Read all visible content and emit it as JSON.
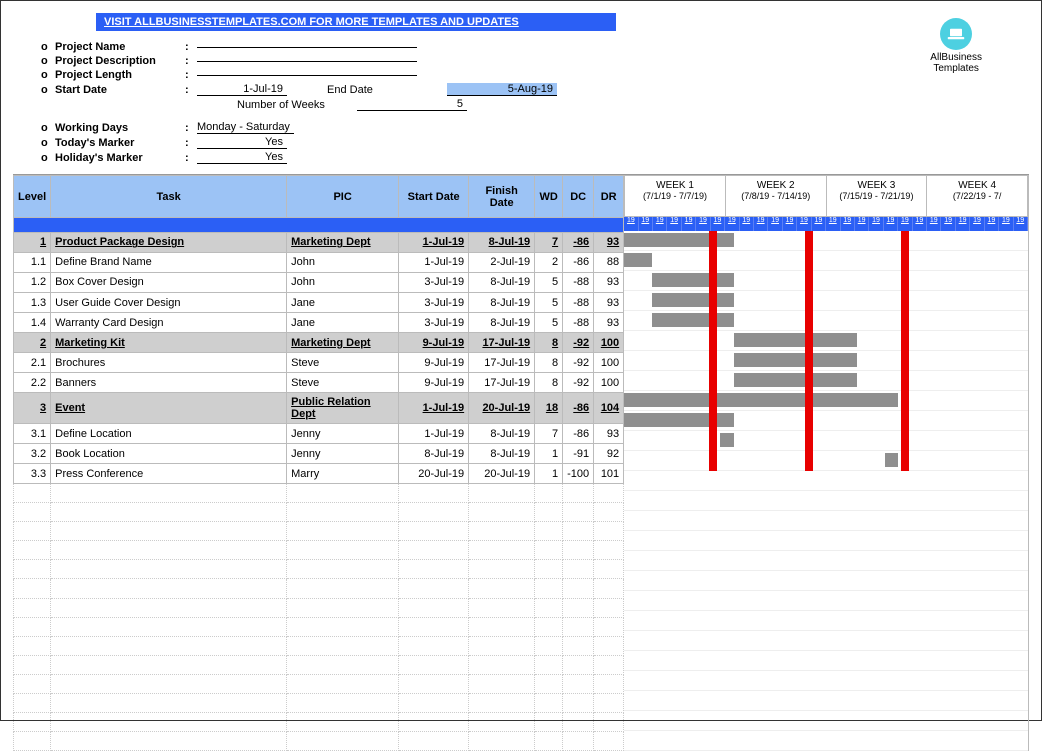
{
  "header_link": "VISIT ALLBUSINESSTEMPLATES.COM FOR MORE TEMPLATES AND UPDATES",
  "logo": {
    "line1": "AllBusiness",
    "line2": "Templates"
  },
  "meta": {
    "rows": [
      {
        "label": "Project Name",
        "value": ""
      },
      {
        "label": "Project Description",
        "value": ""
      },
      {
        "label": "Project Length",
        "value": ""
      },
      {
        "label": "Start Date",
        "value": "1-Jul-19",
        "second_label": "End Date",
        "second_value": "5-Aug-19",
        "second_hl": true
      },
      {
        "label": "",
        "value": "",
        "second_label": "Number of Weeks",
        "second_value": "5"
      },
      {
        "label": "Working Days",
        "value": "Monday - Saturday"
      },
      {
        "label": "Today's Marker",
        "value": "Yes"
      },
      {
        "label": "Holiday's Marker",
        "value": "Yes"
      }
    ]
  },
  "columns": [
    "Level",
    "Task",
    "PIC",
    "Start Date",
    "Finish Date",
    "WD",
    "DC",
    "DR"
  ],
  "weeks": [
    {
      "name": "WEEK 1",
      "range": "(7/1/19 - 7/7/19)"
    },
    {
      "name": "WEEK 2",
      "range": "(7/8/19 - 7/14/19)"
    },
    {
      "name": "WEEK 3",
      "range": "(7/15/19 - 7/21/19)"
    },
    {
      "name": "WEEK 4",
      "range": "(7/22/19 - 7/"
    }
  ],
  "day_label": "19",
  "rows": [
    {
      "level": "1",
      "task": "Product Package Design",
      "pic": "Marketing Dept",
      "sd": "1-Jul-19",
      "fd": "8-Jul-19",
      "wd": "7",
      "dc": "-86",
      "dr": "93",
      "group": true,
      "bar_start": 0,
      "bar_days": 8
    },
    {
      "level": "1.1",
      "task": "Define Brand Name",
      "pic": "John",
      "sd": "1-Jul-19",
      "fd": "2-Jul-19",
      "wd": "2",
      "dc": "-86",
      "dr": "88",
      "bar_start": 0,
      "bar_days": 2
    },
    {
      "level": "1.2",
      "task": "Box Cover Design",
      "pic": "John",
      "sd": "3-Jul-19",
      "fd": "8-Jul-19",
      "wd": "5",
      "dc": "-88",
      "dr": "93",
      "bar_start": 2,
      "bar_days": 6
    },
    {
      "level": "1.3",
      "task": "User Guide Cover Design",
      "pic": "Jane",
      "sd": "3-Jul-19",
      "fd": "8-Jul-19",
      "wd": "5",
      "dc": "-88",
      "dr": "93",
      "bar_start": 2,
      "bar_days": 6
    },
    {
      "level": "1.4",
      "task": "Warranty Card Design",
      "pic": "Jane",
      "sd": "3-Jul-19",
      "fd": "8-Jul-19",
      "wd": "5",
      "dc": "-88",
      "dr": "93",
      "bar_start": 2,
      "bar_days": 6
    },
    {
      "level": "2",
      "task": "Marketing Kit",
      "pic": "Marketing Dept",
      "sd": "9-Jul-19",
      "fd": "17-Jul-19",
      "wd": "8",
      "dc": "-92",
      "dr": "100",
      "group": true,
      "bar_start": 8,
      "bar_days": 9
    },
    {
      "level": "2.1",
      "task": "Brochures",
      "pic": "Steve",
      "sd": "9-Jul-19",
      "fd": "17-Jul-19",
      "wd": "8",
      "dc": "-92",
      "dr": "100",
      "bar_start": 8,
      "bar_days": 9
    },
    {
      "level": "2.2",
      "task": "Banners",
      "pic": "Steve",
      "sd": "9-Jul-19",
      "fd": "17-Jul-19",
      "wd": "8",
      "dc": "-92",
      "dr": "100",
      "bar_start": 8,
      "bar_days": 9
    },
    {
      "level": "3",
      "task": "Event",
      "pic": "Public Relation Dept",
      "sd": "1-Jul-19",
      "fd": "20-Jul-19",
      "wd": "18",
      "dc": "-86",
      "dr": "104",
      "group": true,
      "bar_start": 0,
      "bar_days": 20
    },
    {
      "level": "3.1",
      "task": "Define Location",
      "pic": "Jenny",
      "sd": "1-Jul-19",
      "fd": "8-Jul-19",
      "wd": "7",
      "dc": "-86",
      "dr": "93",
      "bar_start": 0,
      "bar_days": 8
    },
    {
      "level": "3.2",
      "task": "Book Location",
      "pic": "Jenny",
      "sd": "8-Jul-19",
      "fd": "8-Jul-19",
      "wd": "1",
      "dc": "-91",
      "dr": "92",
      "bar_start": 7,
      "bar_days": 1
    },
    {
      "level": "3.3",
      "task": "Press Conference",
      "pic": "Marry",
      "sd": "20-Jul-19",
      "fd": "20-Jul-19",
      "wd": "1",
      "dc": "-100",
      "dr": "101",
      "bar_start": 19,
      "bar_days": 1
    }
  ],
  "markers_days": [
    7,
    14,
    21
  ],
  "empty_rows": 14,
  "chart_data": {
    "type": "gantt",
    "x_start": "2019-07-01",
    "tasks": [
      {
        "name": "Product Package Design",
        "start": "2019-07-01",
        "end": "2019-07-08"
      },
      {
        "name": "Define Brand Name",
        "start": "2019-07-01",
        "end": "2019-07-02"
      },
      {
        "name": "Box Cover Design",
        "start": "2019-07-03",
        "end": "2019-07-08"
      },
      {
        "name": "User Guide Cover Design",
        "start": "2019-07-03",
        "end": "2019-07-08"
      },
      {
        "name": "Warranty Card Design",
        "start": "2019-07-03",
        "end": "2019-07-08"
      },
      {
        "name": "Marketing Kit",
        "start": "2019-07-09",
        "end": "2019-07-17"
      },
      {
        "name": "Brochures",
        "start": "2019-07-09",
        "end": "2019-07-17"
      },
      {
        "name": "Banners",
        "start": "2019-07-09",
        "end": "2019-07-17"
      },
      {
        "name": "Event",
        "start": "2019-07-01",
        "end": "2019-07-20"
      },
      {
        "name": "Define Location",
        "start": "2019-07-01",
        "end": "2019-07-08"
      },
      {
        "name": "Book Location",
        "start": "2019-07-08",
        "end": "2019-07-08"
      },
      {
        "name": "Press Conference",
        "start": "2019-07-20",
        "end": "2019-07-20"
      }
    ]
  }
}
